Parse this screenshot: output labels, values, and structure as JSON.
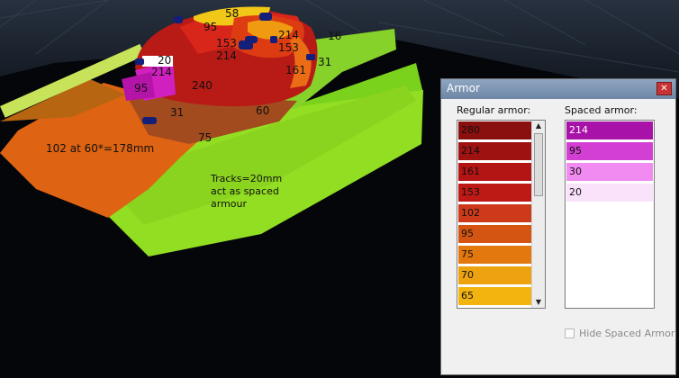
{
  "scene": {
    "tank_labels": [
      "58",
      "95",
      "214",
      "16",
      "153",
      "153",
      "214",
      "161",
      "31",
      "20",
      "214",
      "95",
      "240",
      "31",
      "60",
      "75"
    ],
    "front_plate_label": "102 at 60*=178mm",
    "tracks_note": "Tracks=20mm\nact as spaced\narmour"
  },
  "armor_window": {
    "title": "Armor",
    "close_icon": "close-icon",
    "regular_title": "Regular armor:",
    "spaced_title": "Spaced armor:",
    "regular_items": [
      {
        "value": "280",
        "color": "#8a1010"
      },
      {
        "value": "214",
        "color": "#9f1212"
      },
      {
        "value": "161",
        "color": "#b31414"
      },
      {
        "value": "153",
        "color": "#bd1a16"
      },
      {
        "value": "102",
        "color": "#cc3a1a"
      },
      {
        "value": "95",
        "color": "#d45512"
      },
      {
        "value": "75",
        "color": "#e3780f"
      },
      {
        "value": "70",
        "color": "#eca30f"
      },
      {
        "value": "65",
        "color": "#f3b40f"
      }
    ],
    "spaced_items": [
      {
        "value": "214",
        "color": "#a812a8"
      },
      {
        "value": "95",
        "color": "#d33fd3"
      },
      {
        "value": "30",
        "color": "#f18af1"
      },
      {
        "value": "20",
        "color": "#fbe2fb"
      }
    ],
    "hide_spaced_label": "Hide Spaced Armor",
    "hide_spaced_checked": false
  }
}
